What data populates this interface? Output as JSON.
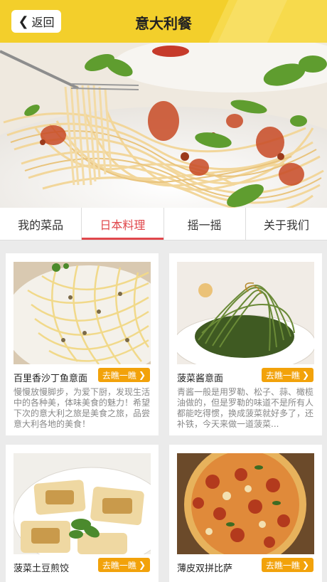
{
  "header": {
    "back_label": "返回",
    "title": "意大利餐"
  },
  "tabs": [
    {
      "label": "我的菜品"
    },
    {
      "label": "日本料理"
    },
    {
      "label": "摇一摇"
    },
    {
      "label": "关于我们"
    }
  ],
  "cards": [
    {
      "name": "百里香沙丁鱼意面",
      "more_label": "去瞧一瞧",
      "desc": "慢慢放慢脚步，为爱下厨，发现生活中的各种美，体味美食的魅力！希望下次的意大利之旅是美食之旅，品尝意大利各地的美食！"
    },
    {
      "name": "菠菜酱意面",
      "more_label": "去瞧一瞧",
      "desc": "青酱一般是用罗勒、松子、蒜、橄榄油做的，但是罗勒的味道不是所有人都能吃得惯，换成菠菜就好多了，还补铁，今天来做一道菠菜..."
    },
    {
      "name": "菠菜土豆煎饺",
      "more_label": "去瞧一瞧"
    },
    {
      "name": "薄皮双拼比萨",
      "more_label": "去瞧一瞧"
    }
  ]
}
